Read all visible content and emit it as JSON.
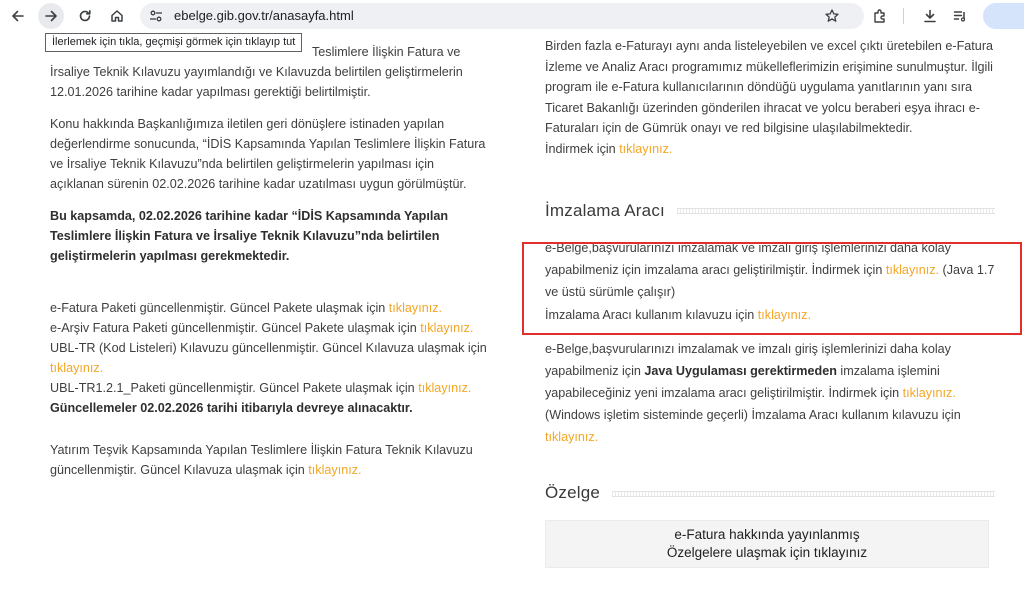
{
  "browser": {
    "url": "ebelge.gib.gov.tr/anasayfa.html",
    "tooltip": "İlerlemek için tıkla, geçmişi görmek için tıklayıp tut",
    "icons": [
      "back-icon",
      "forward-icon",
      "reload-icon",
      "home-icon",
      "site-info-icon",
      "bookmark-star-icon",
      "extensions-icon",
      "download-icon",
      "reading-list-icon"
    ]
  },
  "left": {
    "p1_pre": "Teslimlere İlişkin Fatura ve İrsaliye Teknik Kılavuzu yayımlandığı ve Kılavuzda belirtilen geliştirmelerin 12.01.2026 tarihine kadar yapılması gerektiği belirtilmiştir.",
    "p2": "Konu hakkında Başkanlığımıza iletilen geri dönüşlere istinaden yapılan değerlendirme sonucunda, “İDİS Kapsamında Yapılan Teslimlere İlişkin Fatura ve İrsaliye Teknik Kılavuzu”nda belirtilen geliştirmelerin yapılması için açıklanan sürenin 02.02.2026 tarihine kadar uzatılması uygun görülmüştür.",
    "p3_bold": "Bu kapsamda, 02.02.2026 tarihine kadar “İDİS Kapsamında Yapılan Teslimlere İlişkin Fatura ve İrsaliye Teknik Kılavuzu”nda belirtilen geliştirmelerin yapılması gerekmektedir.",
    "u1_text": "e-Fatura Paketi güncellenmiştir. Güncel Pakete ulaşmak için ",
    "u2_text": "e-Arşiv Fatura Paketi güncellenmiştir. Güncel Pakete ulaşmak için ",
    "u3_text": "UBL-TR (Kod Listeleri) Kılavuzu güncellenmiştir. Güncel Kılavuza ulaşmak için ",
    "u4_text": "UBL-TR1.2.1_Paketi güncellenmiştir. Güncel Pakete ulaşmak için ",
    "u5_bold": "Güncellemeler 02.02.2026 tarihi itibarıyla devreye alınacaktır.",
    "p4_text": "Yatırım Teşvik Kapsamında Yapılan Teslimlere İlişkin Fatura Teknik Kılavuzu güncellenmiştir. Güncel Kılavuza ulaşmak için ",
    "link": "tıklayınız."
  },
  "right": {
    "r1_text": "Birden fazla e-Faturayı aynı anda listeleyebilen ve excel çıktı üretebilen e-Fatura İzleme ve Analiz Aracı programımız mükelleflerimizin erişimine sunulmuştur. İlgili program ile e-Fatura kullanıcılarının döndüğü uygulama yanıtlarının yanı sıra Ticaret Bakanlığı üzerinden gönderilen ihracat ve yolcu beraberi eşya ihracı e-Faturaları için de Gümrük onayı ve red bilgisine ulaşılabilmektedir.",
    "r1_download": "İndirmek için ",
    "imza_title": "İmzalama Aracı",
    "imza1_text": "e-Belge,başvurularınızı imzalamak ve imzalı giriş işlemlerinizi daha kolay yapabilmeniz için imzalama aracı geliştirilmiştir. İndirmek için ",
    "imza1_after": " (Java 1.7 ve üstü sürümle çalışır)",
    "imza_guide": "İmzalama Aracı kullanım kılavuzu için ",
    "imza2_pre": "e-Belge,başvurularınızı imzalamak ve imzalı giriş işlemlerinizi daha kolay yapabilmeniz için ",
    "imza2_bold": "Java Uygulaması gerektirmeden",
    "imza2_post": " imzalama işlemini yapabileceğiniz yeni imzalama aracı geliştirilmiştir. İndirmek için ",
    "imza2_tail": " (Windows işletim sisteminde geçerli) İmzalama Aracı kullanım kılavuzu için ",
    "ozelge_title": "Özelge",
    "ozelge_line1": "e-Fatura hakkında yayınlanmış",
    "ozelge_line2": "Özelgelere ulaşmak için tıklayınız",
    "link": "tıklayınız."
  },
  "colors": {
    "link": "#f3a626",
    "highlight": "#e0302b",
    "text": "#3f3f3f"
  }
}
